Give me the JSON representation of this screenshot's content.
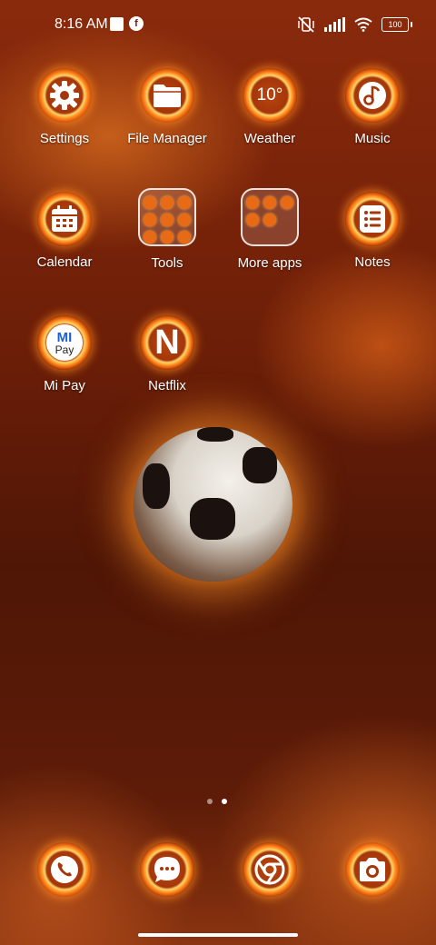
{
  "status_bar": {
    "time": "8:16 AM",
    "battery": "100",
    "notification_app_letter": "f"
  },
  "apps": [
    {
      "id": "settings",
      "label": "Settings",
      "icon": "gear-icon"
    },
    {
      "id": "file-manager",
      "label": "File Manager",
      "icon": "folder-icon"
    },
    {
      "id": "weather",
      "label": "Weather",
      "icon_text": "10°"
    },
    {
      "id": "music",
      "label": "Music",
      "icon": "music-note-icon"
    },
    {
      "id": "calendar",
      "label": "Calendar",
      "icon": "calendar-icon"
    },
    {
      "id": "tools",
      "label": "Tools",
      "icon": "folder-group"
    },
    {
      "id": "more-apps",
      "label": "More apps",
      "icon": "folder-group"
    },
    {
      "id": "notes",
      "label": "Notes",
      "icon": "notes-list-icon"
    },
    {
      "id": "mi-pay",
      "label": "Mi Pay",
      "icon_text_top": "MI",
      "icon_text_bottom": "Pay"
    },
    {
      "id": "netflix",
      "label": "Netflix",
      "icon_text": "N"
    }
  ],
  "dock": [
    {
      "id": "phone",
      "icon": "phone-icon"
    },
    {
      "id": "messages",
      "icon": "chat-bubble-icon"
    },
    {
      "id": "chrome",
      "icon": "chrome-icon"
    },
    {
      "id": "camera",
      "icon": "camera-icon"
    }
  ],
  "page_indicator": {
    "count": 2,
    "active": 2
  },
  "colors": {
    "flame": "#ff8a1c",
    "ring_inner": "#a5360a",
    "background_dark": "#4f1606"
  }
}
